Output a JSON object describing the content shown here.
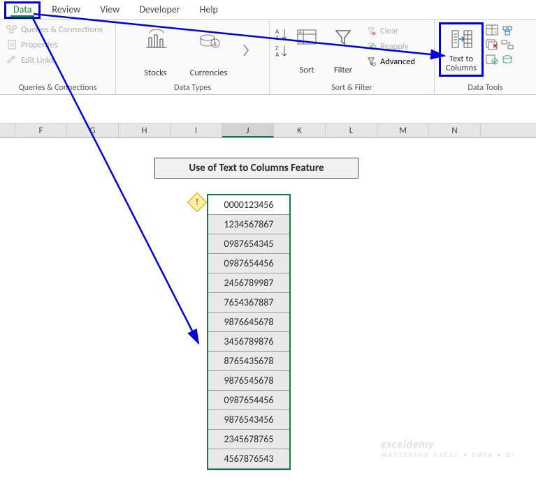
{
  "tabs": {
    "data": "Data",
    "review": "Review",
    "view": "View",
    "developer": "Developer",
    "help": "Help"
  },
  "ribbon": {
    "queries": {
      "qc": "Queries & Connections",
      "props": "Properties",
      "links": "Edit Links",
      "label": "Queries & Connections"
    },
    "types": {
      "stocks": "Stocks",
      "curr": "Currencies",
      "label": "Data Types"
    },
    "sort": {
      "sort": "Sort",
      "filter": "Filter",
      "clear": "Clear",
      "reapply": "Reapply",
      "adv": "Advanced",
      "label": "Sort & Filter"
    },
    "tools": {
      "t2c1": "Text to",
      "t2c2": "Columns",
      "label": "Data Tools"
    }
  },
  "columns": [
    "F",
    "G",
    "H",
    "I",
    "J",
    "K",
    "L",
    "M",
    "N"
  ],
  "selected_col": "J",
  "title": "Use of Text to Columns Feature",
  "data_values": [
    "0000123456",
    "1234567867",
    "0987654345",
    "0987654456",
    "2456789987",
    "7654367887",
    "9876645678",
    "3456789876",
    "8765435678",
    "9876545678",
    "0987654456",
    "9876543456",
    "2345678765",
    "4567876543"
  ],
  "watermark": {
    "main": "exceldemy",
    "sub": "MASTERING EXCEL • DATA • BI"
  }
}
